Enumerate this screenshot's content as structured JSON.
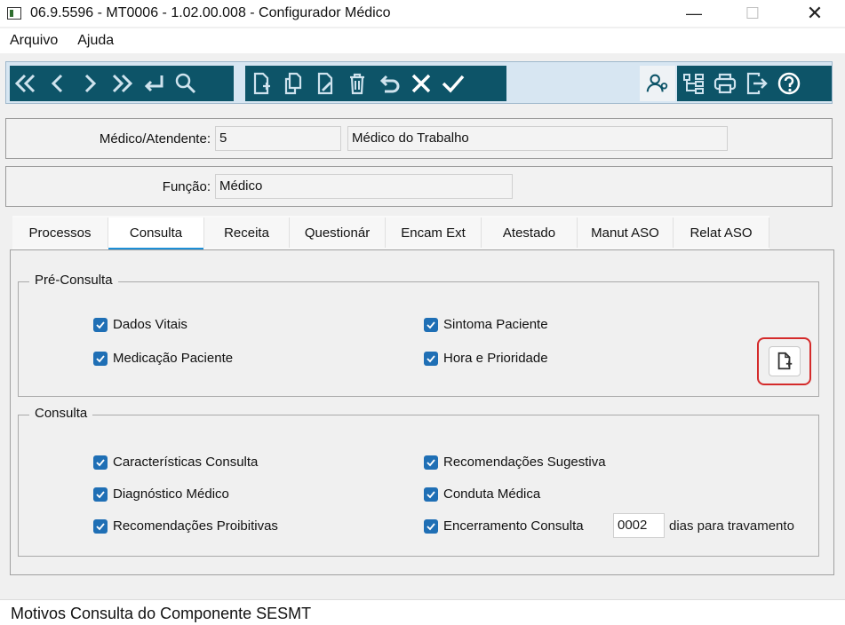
{
  "window": {
    "title": "06.9.5596 - MT0006 - 1.02.00.008 - Configurador Médico",
    "minimize": "—",
    "maximize": "☐",
    "close": "✕"
  },
  "menu": [
    "Arquivo",
    "Ajuda"
  ],
  "toolbar": {
    "nav_icons": [
      "first-icon",
      "previous-icon",
      "next-icon",
      "last-icon",
      "return-icon",
      "search-icon"
    ],
    "edit_icons": [
      "new-icon",
      "copy-icon",
      "edit-icon",
      "delete-icon",
      "undo-icon",
      "cancel-icon",
      "confirm-icon"
    ],
    "right_icons": [
      "user-settings-icon",
      "tree-icon",
      "print-icon",
      "exit-icon",
      "help-icon"
    ]
  },
  "fields": {
    "medico_label": "Médico/Atendente:",
    "medico_code": "5",
    "medico_desc": "Médico do Trabalho",
    "funcao_label": "Função:",
    "funcao_value": "Médico"
  },
  "tabs": [
    "Processos",
    "Consulta",
    "Receita",
    "Questionár",
    "Encam Ext",
    "Atestado",
    "Manut ASO",
    "Relat ASO"
  ],
  "active_tab": "Consulta",
  "pre_consulta": {
    "title": "Pré-Consulta",
    "items": [
      "Dados Vitais",
      "Sintoma Paciente",
      "Medicação Paciente",
      "Hora e Prioridade"
    ]
  },
  "consulta": {
    "title": "Consulta",
    "items": [
      "Características Consulta",
      "Recomendações Sugestiva",
      "Diagnóstico Médico",
      "Conduta Médica",
      "Recomendações Proibitivas",
      "Encerramento Consulta"
    ],
    "days_value": "0002",
    "days_label": "dias para travamento"
  },
  "status": "Motivos Consulta do Componente SESMT",
  "colors": {
    "toolbar": "#0d5468",
    "accent": "#1d8fd6",
    "checkbox": "#1f6fb5",
    "highlight": "#d42a2a"
  }
}
